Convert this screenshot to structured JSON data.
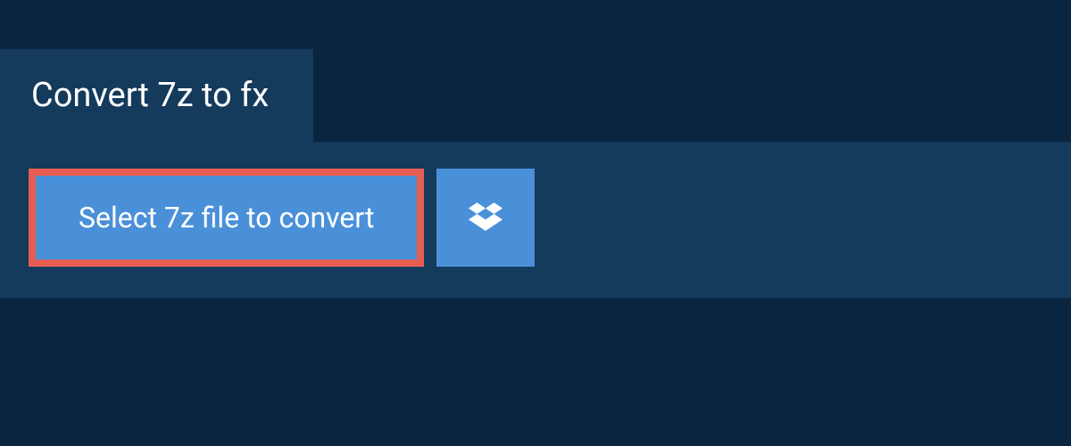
{
  "header": {
    "title": "Convert 7z to fx"
  },
  "actions": {
    "select_label": "Select 7z file to convert",
    "dropbox_icon": "dropbox"
  },
  "colors": {
    "background": "#0a2540",
    "panel": "#143a5c",
    "button": "#4a90d9",
    "highlight_border": "#e85d52",
    "text": "#ffffff"
  }
}
